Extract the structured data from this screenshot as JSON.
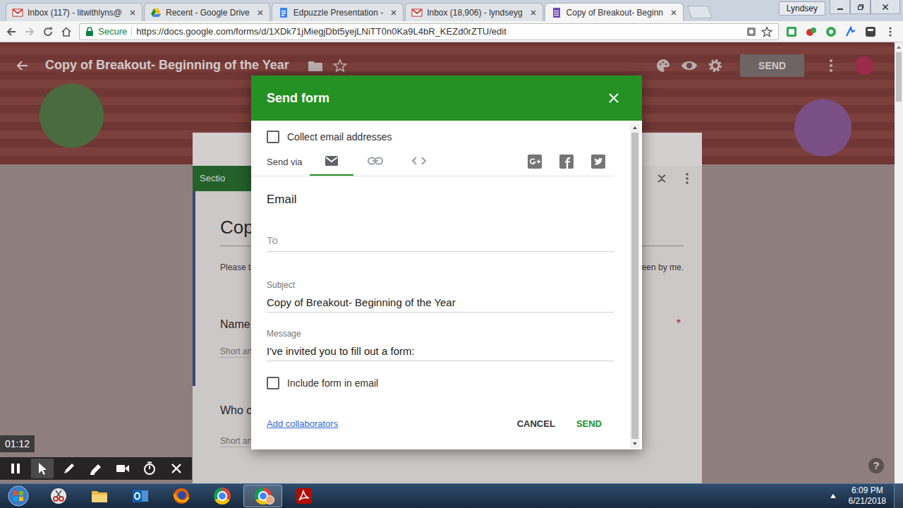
{
  "browser": {
    "tabs": [
      {
        "label": "Inbox (117) - litwithlyns@",
        "kind": "gmail",
        "selected": false
      },
      {
        "label": "Recent - Google Drive",
        "kind": "drive",
        "selected": false
      },
      {
        "label": "Edpuzzle Presentation -",
        "kind": "docs",
        "selected": false
      },
      {
        "label": "Inbox (18,906) - lyndseyg",
        "kind": "gmail",
        "selected": false
      },
      {
        "label": "Copy of Breakout- Beginn",
        "kind": "forms",
        "selected": true
      }
    ],
    "user": "Lyndsey",
    "secure_label": "Secure",
    "url": "https://docs.google.com/forms/d/1XDk71jMiegjDbt5yejLNiTT0n0Ka9L4bR_KEZd0rZTU/edit"
  },
  "form_header": {
    "title": "Copy of Breakout- Beginning of the Year",
    "send_label": "SEND",
    "send_disabled": true
  },
  "form_card": {
    "section_tab": "Sectio",
    "title": "Cop",
    "description_start": "Please ta",
    "description_end": "een by me.",
    "required_mark": "*",
    "questions": [
      {
        "label": "Name",
        "hint": "Short an",
        "required": true
      },
      {
        "label": "Who c",
        "hint": "Short an",
        "required": false
      }
    ]
  },
  "dialog": {
    "title": "Send form",
    "collect": {
      "label": "Collect email addresses",
      "checked": false
    },
    "send_via_label": "Send via",
    "send_via": [
      {
        "kind": "email",
        "selected": true
      },
      {
        "kind": "link",
        "selected": false
      },
      {
        "kind": "embed",
        "selected": false
      }
    ],
    "section_heading": "Email",
    "to_placeholder": "To",
    "subject_label": "Subject",
    "subject_value": "Copy of Breakout- Beginning of the Year",
    "message_label": "Message",
    "message_value": "I've invited you to fill out a form:",
    "include": {
      "label": "Include form in email",
      "checked": false
    },
    "add_collaborators": "Add collaborators",
    "buttons": [
      {
        "label": "CANCEL",
        "primary": false
      },
      {
        "label": "SEND",
        "primary": true
      }
    ]
  },
  "recorder": {
    "time": "01:12",
    "tools": [
      {
        "kind": "pause",
        "selected": false
      },
      {
        "kind": "pointer",
        "selected": true
      },
      {
        "kind": "pen",
        "selected": false
      },
      {
        "kind": "highlighter",
        "selected": false
      },
      {
        "kind": "camera",
        "selected": false
      },
      {
        "kind": "timer",
        "selected": false
      },
      {
        "kind": "close",
        "selected": false
      }
    ]
  },
  "help": "?",
  "taskbar": {
    "apps": [
      {
        "kind": "snipping",
        "selected": false
      },
      {
        "kind": "explorer",
        "selected": false
      },
      {
        "kind": "outlook",
        "selected": false
      },
      {
        "kind": "firefox",
        "selected": false
      },
      {
        "kind": "chrome",
        "selected": false
      },
      {
        "kind": "chrome-profile",
        "selected": true
      },
      {
        "kind": "acrobat",
        "selected": false
      }
    ],
    "time": "6:09 PM",
    "date": "6/21/2018"
  }
}
